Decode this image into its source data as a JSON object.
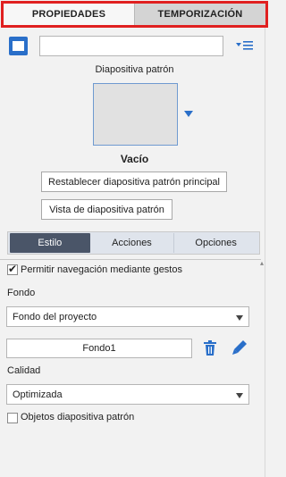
{
  "tabs": {
    "properties": "PROPIEDADES",
    "timing": "TEMPORIZACIÓN"
  },
  "slide": {
    "name_value": "",
    "master_label": "Diapositiva patrón",
    "thumbnail_label": "Vacío"
  },
  "buttons": {
    "reset_master": "Restablecer diapositiva patrón principal",
    "master_view": "Vista de diapositiva patrón"
  },
  "subtabs": {
    "style": "Estilo",
    "actions": "Acciones",
    "options": "Opciones"
  },
  "options": {
    "gestures_label": "Permitir navegación mediante gestos",
    "gestures_checked": true,
    "background_label": "Fondo",
    "background_select": "Fondo del proyecto",
    "background_name": "Fondo1",
    "quality_label": "Calidad",
    "quality_select": "Optimizada",
    "master_objects_label": "Objetos diapositiva patrón",
    "master_objects_checked": false
  },
  "colors": {
    "accent_blue": "#2a6fc9",
    "highlight_red": "#e02020",
    "active_subtab": "#4a5568"
  },
  "icons": [
    "slide-icon",
    "list-menu-icon",
    "dropdown-arrow-icon",
    "trash-icon",
    "pen-icon",
    "checkbox-checked",
    "checkbox-empty"
  ]
}
